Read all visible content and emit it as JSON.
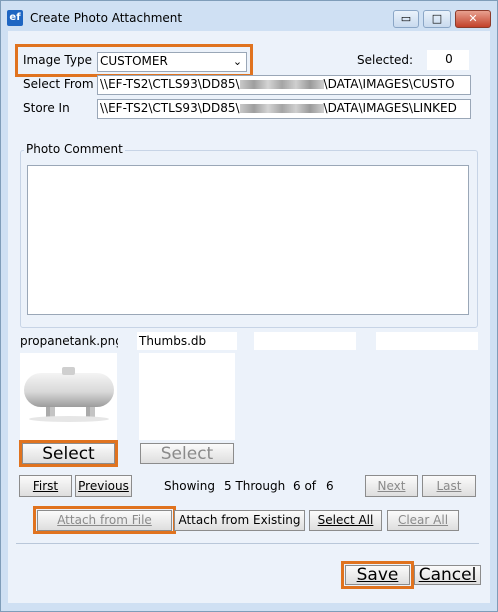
{
  "window": {
    "title": "Create Photo Attachment",
    "app_icon_text": "ef",
    "minimize_symbol": "▭",
    "maximize_symbol": "□",
    "close_symbol": "✕"
  },
  "form": {
    "image_type_label": "Image Type",
    "image_type_value": "CUSTOMER",
    "selected_label": "Selected:",
    "selected_value": "0",
    "select_from_label": "Select From",
    "select_from_prefix": "\\\\EF-TS2\\CTLS93\\DD85\\",
    "select_from_suffix": "\\DATA\\IMAGES\\CUSTO",
    "store_in_label": "Store In",
    "store_in_prefix": "\\\\EF-TS2\\CTLS93\\DD85\\",
    "store_in_suffix": "\\DATA\\IMAGES\\LINKED",
    "photo_comment_label": "Photo Comment",
    "photo_comment_value": ""
  },
  "thumbnails": [
    {
      "name": "propanetank.png",
      "select_label": "Select",
      "enabled": true
    },
    {
      "name": "Thumbs.db",
      "select_label": "Select",
      "enabled": false
    },
    {
      "name": ""
    },
    {
      "name": ""
    }
  ],
  "pager": {
    "first": "First",
    "previous": "Previous",
    "showing": "Showing",
    "range": "5 Through",
    "of_label": "6 of",
    "total": "6",
    "next": "Next",
    "last": "Last"
  },
  "actions": {
    "attach_from_file": "Attach from File",
    "attach_from_existing": "Attach from Existing",
    "select_all": "Select All",
    "clear_all": "Clear All"
  },
  "footer": {
    "save": "Save",
    "cancel": "Cancel"
  },
  "colors": {
    "highlight": "#e0731f",
    "window_bg": "#cfe0f3",
    "client_bg": "#ecf2fa"
  }
}
